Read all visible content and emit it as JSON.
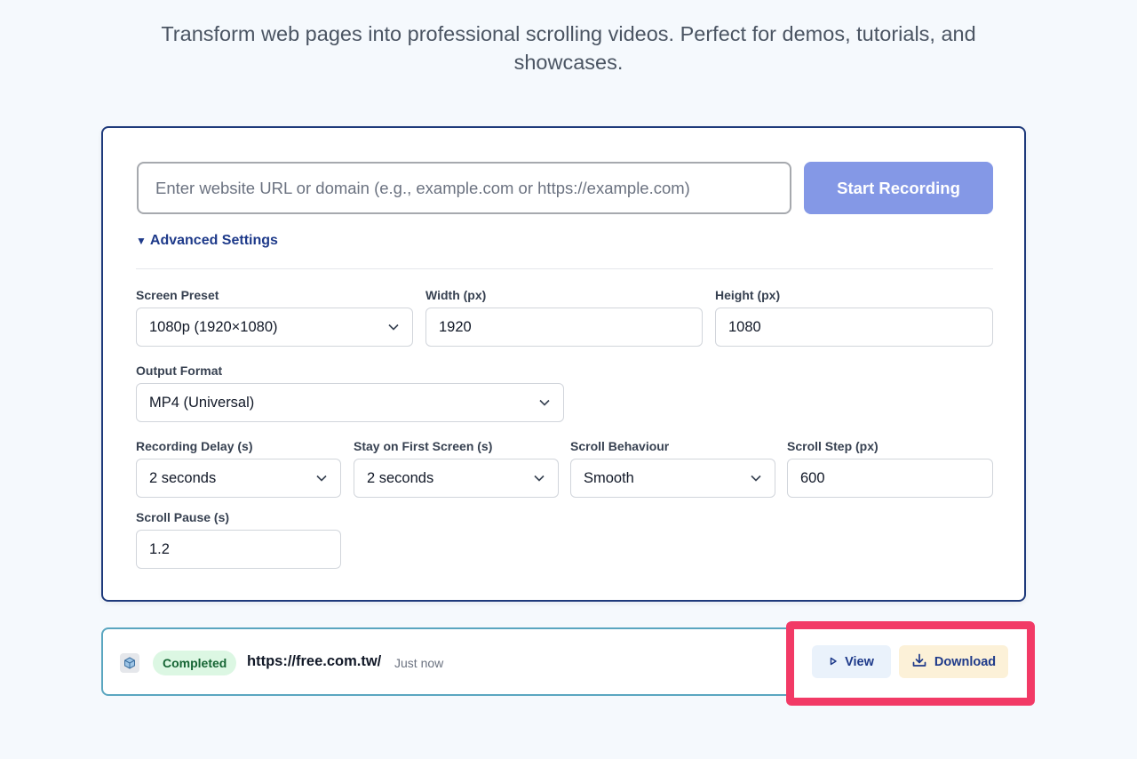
{
  "header": {
    "tagline_line1": "Transform web pages into professional scrolling videos. Perfect for demos, tutorials, and",
    "tagline_line2": "showcases."
  },
  "recorder": {
    "url_placeholder": "Enter website URL or domain (e.g., example.com or https://example.com)",
    "url_value": "",
    "start_label": "Start Recording",
    "advanced_label": "Advanced Settings",
    "advanced_expanded": true
  },
  "settings": {
    "screen_preset": {
      "label": "Screen Preset",
      "value": "1080p (1920×1080)"
    },
    "width": {
      "label": "Width (px)",
      "value": "1920"
    },
    "height": {
      "label": "Height (px)",
      "value": "1080"
    },
    "output_format": {
      "label": "Output Format",
      "value": "MP4 (Universal)"
    },
    "recording_delay": {
      "label": "Recording Delay (s)",
      "value": "2 seconds"
    },
    "stay_first": {
      "label": "Stay on First Screen (s)",
      "value": "2 seconds"
    },
    "scroll_behaviour": {
      "label": "Scroll Behaviour",
      "value": "Smooth"
    },
    "scroll_step": {
      "label": "Scroll Step (px)",
      "value": "600"
    },
    "scroll_pause": {
      "label": "Scroll Pause (s)",
      "value": "1.2"
    }
  },
  "job": {
    "status": "Completed",
    "url": "https://free.com.tw/",
    "time": "Just now",
    "view_label": "View",
    "download_label": "Download",
    "status_color": "#166534",
    "highlight_color": "#f23a66"
  }
}
